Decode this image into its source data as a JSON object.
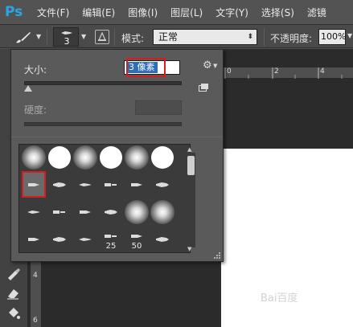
{
  "app": {
    "logo": "Ps"
  },
  "menu": [
    {
      "label": "文件(F)"
    },
    {
      "label": "编辑(E)"
    },
    {
      "label": "图像(I)"
    },
    {
      "label": "图层(L)"
    },
    {
      "label": "文字(Y)"
    },
    {
      "label": "选择(S)"
    },
    {
      "label": "滤镜"
    }
  ],
  "options_bar": {
    "tool_icon": "brush-icon",
    "brush_size_preview": "3",
    "mode_label": "模式:",
    "mode_value": "正常",
    "opacity_label": "不透明度:",
    "opacity_value": "100%"
  },
  "brush_panel": {
    "size_label": "大小:",
    "size_value": "3 像素",
    "hardness_label": "硬度:",
    "size_slider": 0.01,
    "settings_icon": "gear-icon",
    "presets": [
      {
        "kind": "soft",
        "label": ""
      },
      {
        "kind": "hard",
        "label": ""
      },
      {
        "kind": "soft",
        "label": ""
      },
      {
        "kind": "hard",
        "label": ""
      },
      {
        "kind": "soft",
        "label": ""
      },
      {
        "kind": "hard",
        "label": ""
      },
      {
        "kind": "tip",
        "label": "",
        "selected": true
      },
      {
        "kind": "tip",
        "label": ""
      },
      {
        "kind": "tip",
        "label": ""
      },
      {
        "kind": "tip",
        "label": ""
      },
      {
        "kind": "tip",
        "label": ""
      },
      {
        "kind": "tip",
        "label": ""
      },
      {
        "kind": "tip",
        "label": ""
      },
      {
        "kind": "tip",
        "label": ""
      },
      {
        "kind": "tip",
        "label": ""
      },
      {
        "kind": "tip",
        "label": ""
      },
      {
        "kind": "soft",
        "label": ""
      },
      {
        "kind": "soft",
        "label": ""
      },
      {
        "kind": "tip",
        "label": ""
      },
      {
        "kind": "tip",
        "label": ""
      },
      {
        "kind": "tip",
        "label": ""
      },
      {
        "kind": "tip",
        "label": "25"
      },
      {
        "kind": "tip",
        "label": "50"
      },
      {
        "kind": "tip",
        "label": ""
      }
    ]
  },
  "rulers": {
    "top": [
      "0",
      "2",
      "4"
    ],
    "left": [
      "4",
      "6"
    ]
  },
  "watermark": "Bai百度"
}
